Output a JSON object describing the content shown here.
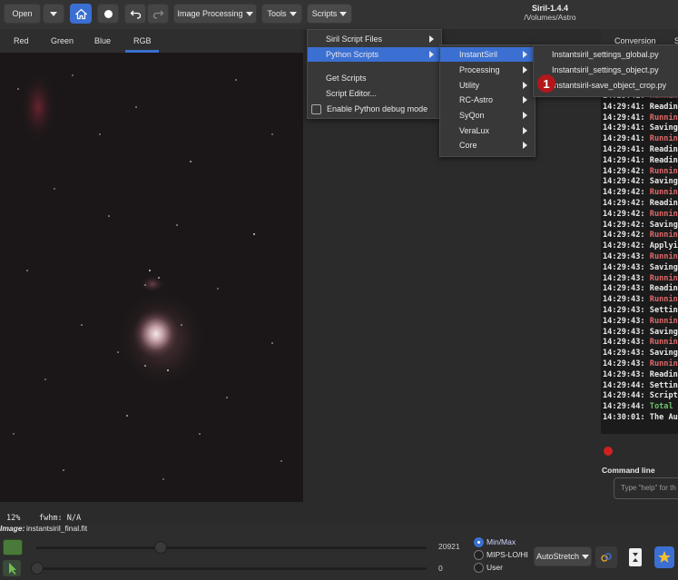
{
  "toolbar": {
    "open_label": "Open",
    "image_processing_label": "Image Processing",
    "tools_label": "Tools",
    "scripts_label": "Scripts"
  },
  "window": {
    "title": "Siril-1.4.4",
    "path": "/Volumes/Astro"
  },
  "tabs": {
    "red": "Red",
    "green": "Green",
    "blue": "Blue",
    "rgb": "RGB"
  },
  "right_tabs": {
    "conversion": "Conversion",
    "next": "S"
  },
  "scripts_menu": {
    "items": [
      "Siril Script Files",
      "Python Scripts",
      "Get Scripts",
      "Script Editor...",
      "Enable Python debug mode"
    ]
  },
  "python_menu": {
    "items": [
      "InstantSiril",
      "Processing",
      "Utility",
      "RC-Astro",
      "SyQon",
      "VeraLux",
      "Core"
    ]
  },
  "instantsiril_menu": {
    "items": [
      "Instantsiril_settings_global.py",
      "Instantsiril_settings_object.py",
      "Instantsiril-save_object_crop.py"
    ]
  },
  "marker": {
    "number": "1"
  },
  "log": [
    {
      "time": "14:29:41:",
      "text": "Running",
      "kind": "run"
    },
    {
      "time": "14:29:41:",
      "text": "Reading",
      "kind": "normal"
    },
    {
      "time": "14:29:41:",
      "text": "Running",
      "kind": "run"
    },
    {
      "time": "14:29:41:",
      "text": "Saving",
      "kind": "normal"
    },
    {
      "time": "14:29:41:",
      "text": "Running",
      "kind": "run"
    },
    {
      "time": "14:29:41:",
      "text": "Reading",
      "kind": "normal"
    },
    {
      "time": "14:29:41:",
      "text": "Reading",
      "kind": "normal"
    },
    {
      "time": "14:29:42:",
      "text": "Running",
      "kind": "run"
    },
    {
      "time": "14:29:42:",
      "text": "Saving",
      "kind": "normal"
    },
    {
      "time": "14:29:42:",
      "text": "Running",
      "kind": "run"
    },
    {
      "time": "14:29:42:",
      "text": "Reading",
      "kind": "normal"
    },
    {
      "time": "14:29:42:",
      "text": "Running",
      "kind": "run"
    },
    {
      "time": "14:29:42:",
      "text": "Saving",
      "kind": "normal"
    },
    {
      "time": "14:29:42:",
      "text": "Running",
      "kind": "run"
    },
    {
      "time": "14:29:42:",
      "text": "Applyin",
      "kind": "normal"
    },
    {
      "time": "14:29:43:",
      "text": "Running",
      "kind": "run"
    },
    {
      "time": "14:29:43:",
      "text": "Saving",
      "kind": "normal"
    },
    {
      "time": "14:29:43:",
      "text": "Running",
      "kind": "run"
    },
    {
      "time": "14:29:43:",
      "text": "Reading",
      "kind": "normal"
    },
    {
      "time": "14:29:43:",
      "text": "Running",
      "kind": "run"
    },
    {
      "time": "14:29:43:",
      "text": "Settin",
      "kind": "normal"
    },
    {
      "time": "14:29:43:",
      "text": "Running",
      "kind": "run"
    },
    {
      "time": "14:29:43:",
      "text": "Saving",
      "kind": "normal"
    },
    {
      "time": "14:29:43:",
      "text": "Running",
      "kind": "run"
    },
    {
      "time": "14:29:43:",
      "text": "Saving",
      "kind": "normal"
    },
    {
      "time": "14:29:43:",
      "text": "Running",
      "kind": "run"
    },
    {
      "time": "14:29:43:",
      "text": "Readin",
      "kind": "normal"
    },
    {
      "time": "14:29:44:",
      "text": "Settin",
      "kind": "normal"
    },
    {
      "time": "14:29:44:",
      "text": "Script",
      "kind": "normal"
    },
    {
      "time": "14:29:44:",
      "text": "Total e",
      "kind": "tot"
    },
    {
      "time": "14:30:01:",
      "text": "The Aut",
      "kind": "normal"
    }
  ],
  "command_line": {
    "label": "Command line",
    "placeholder": "Type \"help\" for th"
  },
  "status": {
    "zoom": "12%",
    "fwhm": "fwhm: N/A",
    "image_label": "Image:",
    "image_name": "instantsiril_final.fit"
  },
  "sliders": {
    "max_value": "20921",
    "min_value": "0"
  },
  "scale_options": {
    "minmax": "Min/Max",
    "mips": "MIPS-LO/HI",
    "user": "User"
  },
  "stretch": {
    "mode": "AutoStretch"
  },
  "colors": {
    "accent": "#3b6fd1",
    "log_running": "#e06a6a",
    "log_total": "#6cc36c",
    "marker": "#b3171c"
  }
}
